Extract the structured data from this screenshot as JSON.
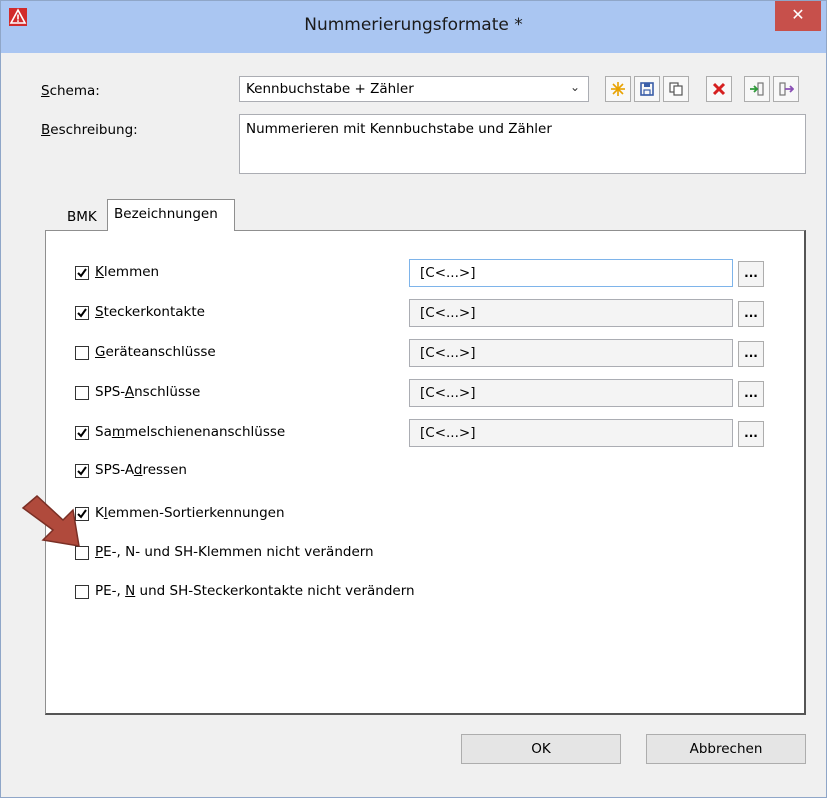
{
  "window": {
    "title": "Nummerierungsformate *",
    "close_glyph": "✕",
    "app_icon": "warning-triangle-icon"
  },
  "form": {
    "schema": {
      "label_mnemonic": "S",
      "label_rest": "chema:",
      "value": "Kennbuchstabe + Zähler"
    },
    "beschreibung": {
      "label_mnemonic": "B",
      "label_rest": "eschreibung:",
      "value": "Nummerieren mit Kennbuchstabe und Zähler"
    }
  },
  "toolbar": [
    {
      "name": "new-schema-button",
      "icon": "sparkle-icon",
      "color": "#e8a200"
    },
    {
      "name": "save-schema-button",
      "icon": "floppy-icon",
      "color": "#3a5ea8"
    },
    {
      "name": "copy-schema-button",
      "icon": "copy-icon",
      "color": "#555555"
    },
    {
      "name": "delete-schema-button",
      "icon": "delete-x-icon",
      "color": "#d62020"
    },
    {
      "name": "import-schema-button",
      "icon": "import-icon",
      "color": "#2e9a3a"
    },
    {
      "name": "export-schema-button",
      "icon": "export-icon",
      "color": "#8a4fb5"
    }
  ],
  "tabs": [
    {
      "label": "BMK",
      "active": false
    },
    {
      "label": "Bezeichnungen",
      "active": true
    }
  ],
  "rows": [
    {
      "pre": "",
      "u": "K",
      "post": "lemmen",
      "checked": true,
      "field": "[C<...>]"
    },
    {
      "pre": "",
      "u": "S",
      "post": "teckerkontakte",
      "checked": true,
      "field": "[C<...>]"
    },
    {
      "pre": "",
      "u": "G",
      "post": "eräteanschlüsse",
      "checked": false,
      "field": "[C<...>]"
    },
    {
      "pre": "SPS-",
      "u": "A",
      "post": "nschlüsse",
      "checked": false,
      "field": "[C<...>]"
    },
    {
      "pre": "Sa",
      "u": "m",
      "post": "melschienenanschlüsse",
      "checked": true,
      "field": "[C<...>]"
    },
    {
      "pre": "SPS-A",
      "u": "d",
      "post": "ressen",
      "checked": true,
      "field": ""
    },
    {
      "pre": "K",
      "u": "l",
      "post": "emmen-Sortierkennungen",
      "checked": true,
      "field": ""
    },
    {
      "pre": "",
      "u": "P",
      "post": "E-, N- und SH-Klemmen nicht verändern",
      "checked": false,
      "field": ""
    },
    {
      "pre": "PE-, ",
      "u": "N",
      "post": " und SH-Steckerkontakte nicht verändern",
      "checked": false,
      "field": ""
    }
  ],
  "field_button_label": "...",
  "buttons": {
    "ok": "OK",
    "cancel": "Abbrechen"
  },
  "colors": {
    "titlebar": "#aac6f2",
    "close": "#c7504b",
    "arrow": "#b04a3c"
  }
}
